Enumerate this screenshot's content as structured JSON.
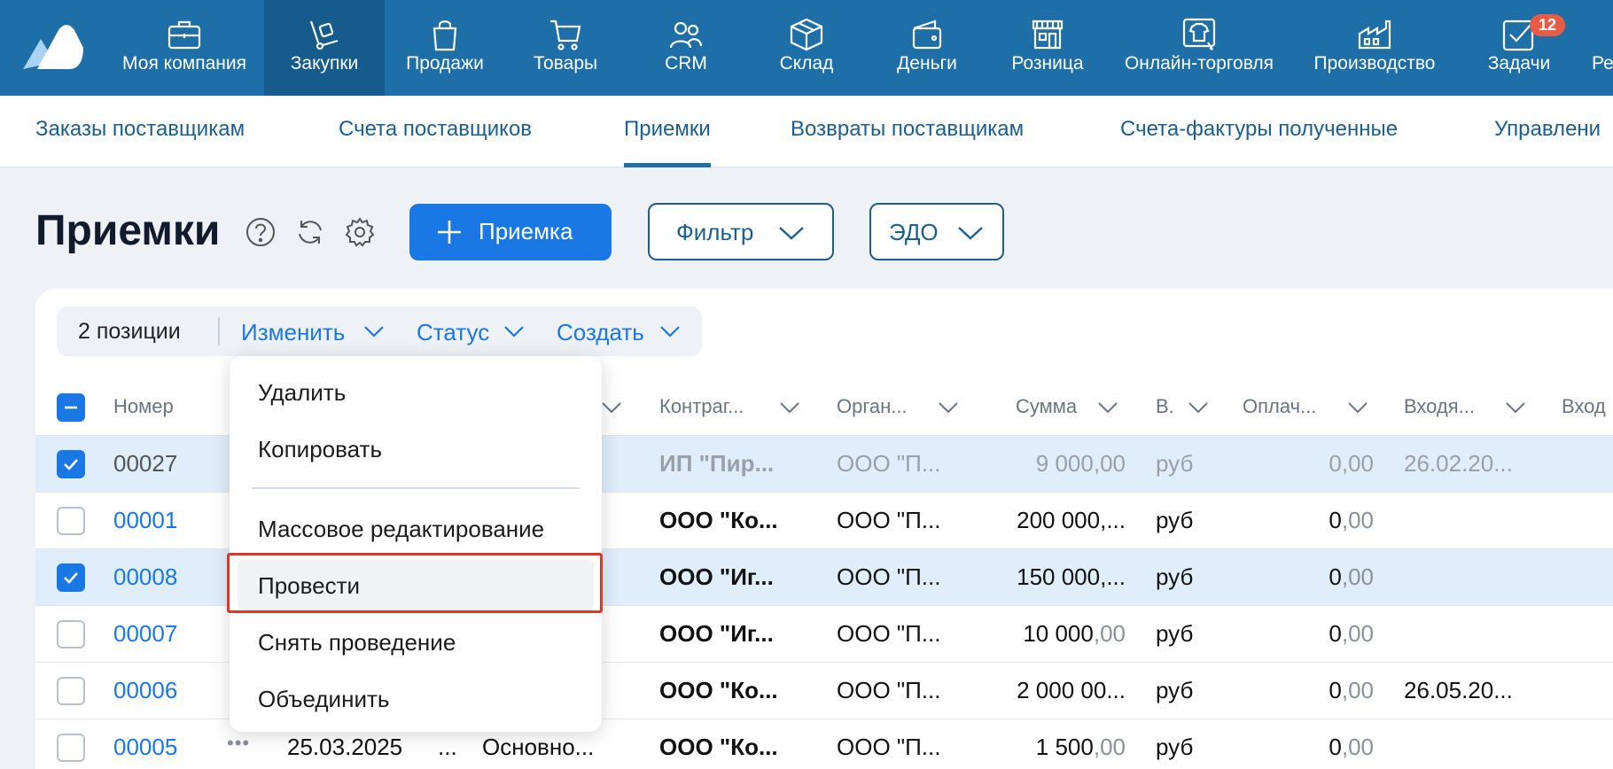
{
  "topnav": {
    "items": [
      {
        "label": "Моя компания",
        "icon": "briefcase-icon"
      },
      {
        "label": "Закупки",
        "icon": "cart-dolly-icon"
      },
      {
        "label": "Продажи",
        "icon": "bag-icon"
      },
      {
        "label": "Товары",
        "icon": "shopping-cart-icon"
      },
      {
        "label": "CRM",
        "icon": "people-icon"
      },
      {
        "label": "Склад",
        "icon": "box-icon"
      },
      {
        "label": "Деньги",
        "icon": "wallet-icon"
      },
      {
        "label": "Розница",
        "icon": "store-icon"
      },
      {
        "label": "Онлайн-торговля",
        "icon": "shirt-icon"
      },
      {
        "label": "Производство",
        "icon": "factory-icon"
      },
      {
        "label": "Задачи",
        "icon": "task-check-icon",
        "badge": "12"
      },
      {
        "label": "Ре",
        "icon": ""
      }
    ],
    "active": "Закупки"
  },
  "subnav": {
    "items": [
      "Заказы поставщикам",
      "Счета поставщиков",
      "Приемки",
      "Возвраты поставщикам",
      "Счета-фактуры полученные",
      "Управлени"
    ],
    "active": "Приемки"
  },
  "header": {
    "title": "Приемки",
    "add_button": "Приемка",
    "filter_button": "Фильтр",
    "edo_button": "ЭДО"
  },
  "toolbar": {
    "count": "2 позиции",
    "edit": "Изменить",
    "status": "Статус",
    "create": "Создать"
  },
  "table": {
    "headers": [
      "Номер",
      "Контраг...",
      "Орган...",
      "Сумма",
      "В.",
      "Оплач...",
      "Входя...",
      "Вход"
    ],
    "rows": [
      {
        "num": "00027",
        "contr": "ИП \"Пир...",
        "org": "ООО \"П...",
        "sum_int": "9 000",
        "sum_dec": ",00",
        "cur": "руб",
        "paid_int": "0",
        "paid_dec": ",00",
        "incoming": "26.02.20...",
        "checked": true,
        "draft": true
      },
      {
        "num": "00001",
        "contr": "ООО \"Ко...",
        "org": "ООО \"П...",
        "sum_int": "200 000,...",
        "sum_dec": "",
        "cur": "руб",
        "paid_int": "0",
        "paid_dec": ",00",
        "incoming": "",
        "checked": false,
        "draft": false
      },
      {
        "num": "00008",
        "contr": "ООО \"Иг...",
        "org": "ООО \"П...",
        "sum_int": "150 000,...",
        "sum_dec": "",
        "cur": "руб",
        "paid_int": "0",
        "paid_dec": ",00",
        "incoming": "",
        "checked": true,
        "draft": false
      },
      {
        "num": "00007",
        "contr": "ООО \"Иг...",
        "org": "ООО \"П...",
        "sum_int": "10 000",
        "sum_dec": ",00",
        "cur": "руб",
        "paid_int": "0",
        "paid_dec": ",00",
        "incoming": "",
        "checked": false,
        "draft": false
      },
      {
        "num": "00006",
        "contr": "ООО \"Ко...",
        "org": "ООО \"П...",
        "sum_int": "2 000 00...",
        "sum_dec": "",
        "cur": "руб",
        "paid_int": "0",
        "paid_dec": ",00",
        "incoming": "26.05.20...",
        "checked": false,
        "draft": false
      },
      {
        "num": "00005",
        "date": "25.03.2025",
        "dots": "...",
        "warehouse": "Основно...",
        "contr": "ООО \"Ко...",
        "org": "ООО \"П...",
        "sum_int": "1 500",
        "sum_dec": ",00",
        "cur": "руб",
        "paid_int": "0",
        "paid_dec": ",00",
        "incoming": "",
        "checked": false,
        "draft": false
      }
    ]
  },
  "dropdown": {
    "items": [
      "Удалить",
      "Копировать",
      "Массовое редактирование",
      "Провести",
      "Снять проведение",
      "Объединить"
    ],
    "highlighted": "Провести"
  }
}
